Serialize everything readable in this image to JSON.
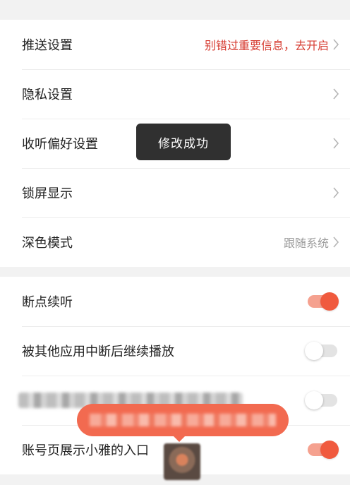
{
  "settings_group_1": {
    "rows": [
      {
        "label": "推送设置",
        "value": "别错过重要信息，去开启"
      },
      {
        "label": "隐私设置",
        "value": ""
      },
      {
        "label": "收听偏好设置",
        "value": ""
      },
      {
        "label": "锁屏显示",
        "value": ""
      },
      {
        "label": "深色模式",
        "value": "跟随系统"
      }
    ]
  },
  "settings_group_2": {
    "rows": [
      {
        "label": "断点续听",
        "toggle_on": true
      },
      {
        "label": "被其他应用中断后继续播放",
        "toggle_on": false
      },
      {
        "label": "",
        "toggle_on": false
      },
      {
        "label": "账号页展示小雅的入口",
        "toggle_on": true
      }
    ]
  },
  "toast": {
    "text": "修改成功"
  },
  "colors": {
    "accent": "#f05a3e",
    "promo_text": "#d63a2f",
    "toast_bg": "#303030",
    "background": "#f2f2f2"
  },
  "icons": {
    "chevron": "chevron-right-icon"
  }
}
